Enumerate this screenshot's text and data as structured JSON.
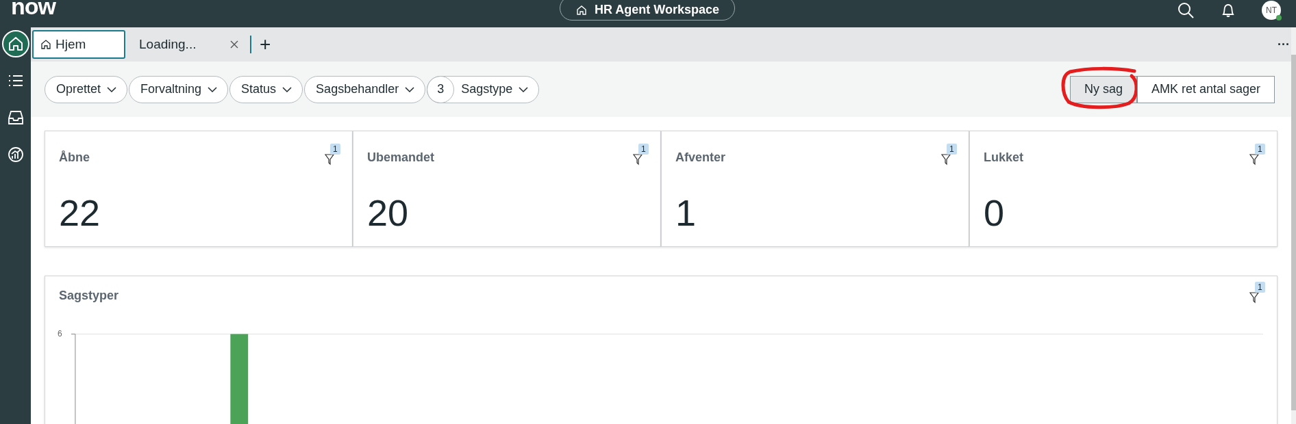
{
  "header": {
    "logo": "now",
    "workspace": "HR Agent Workspace",
    "avatar": "NT",
    "avatar_online": true
  },
  "rail": [
    {
      "kind": "home",
      "selected": true
    },
    {
      "kind": "list",
      "selected": false
    },
    {
      "kind": "inbox",
      "selected": false
    },
    {
      "kind": "analytics",
      "selected": false
    }
  ],
  "tabs": [
    {
      "label": "Hjem",
      "kind": "home",
      "selected": true,
      "closable": false
    },
    {
      "label": "Loading...",
      "kind": "plain",
      "selected": false,
      "closable": true
    }
  ],
  "tab_actions": {
    "add": "+",
    "more": "···"
  },
  "filters": [
    {
      "label": "Oprettet"
    },
    {
      "label": "Forvaltning"
    },
    {
      "label": "Status"
    },
    {
      "label": "Sagsbehandler"
    },
    {
      "label": "Sagstype",
      "count": "3"
    }
  ],
  "buttons": [
    {
      "label": "Ny sag",
      "annotated": true,
      "selected": true
    },
    {
      "label": "AMK ret antal sager",
      "annotated": false,
      "selected": false
    }
  ],
  "cards": [
    {
      "title": "Åbne",
      "value": "22",
      "filter_count": "1"
    },
    {
      "title": "Ubemandet",
      "value": "20",
      "filter_count": "1"
    },
    {
      "title": "Afventer",
      "value": "1",
      "filter_count": "1"
    },
    {
      "title": "Lukket",
      "value": "0",
      "filter_count": "1"
    }
  ],
  "chart_panel": {
    "title": "Sagstyper",
    "filter_count": "1",
    "y_tick": "6"
  }
}
